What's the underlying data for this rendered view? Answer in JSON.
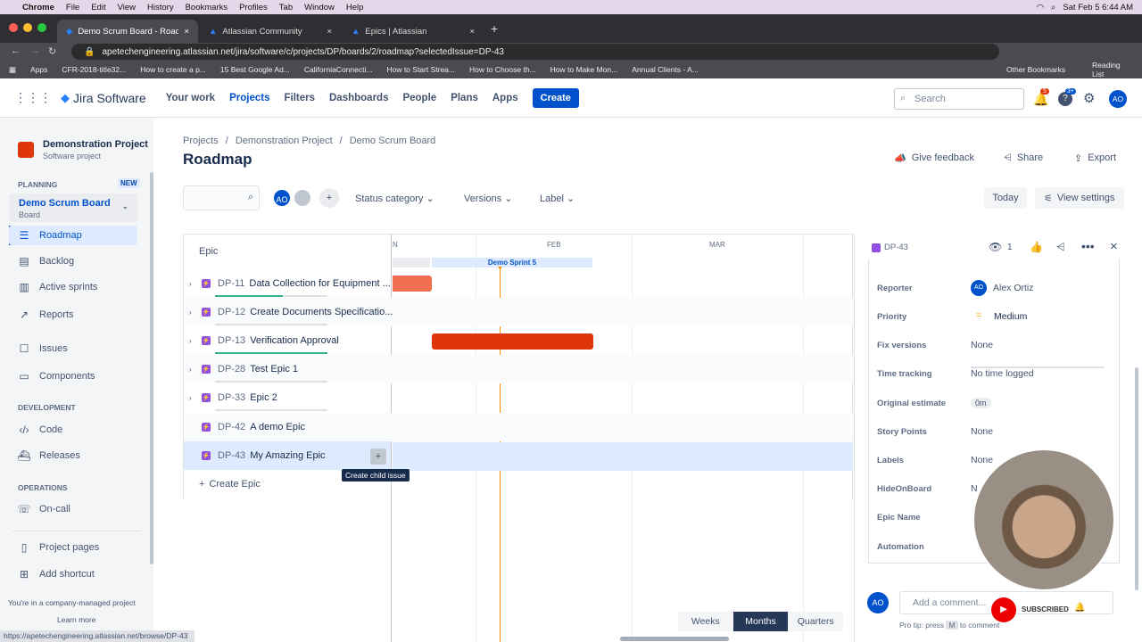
{
  "mac": {
    "apple": "",
    "app": "Chrome",
    "menus": [
      "File",
      "Edit",
      "View",
      "History",
      "Bookmarks",
      "Profiles",
      "Tab",
      "Window",
      "Help"
    ],
    "clock": "Sat Feb 5  6:44 AM"
  },
  "tabs": [
    {
      "label": "Demo Scrum Board - Roadmap"
    },
    {
      "label": "Atlassian Community"
    },
    {
      "label": "Epics | Atlassian"
    }
  ],
  "url": "apetechengineering.atlassian.net/jira/software/c/projects/DP/boards/2/roadmap?selectedIssue=DP-43",
  "bookmarks": [
    "Apps",
    "CFR-2018-title32...",
    "How to create a p...",
    "15 Best Google Ad...",
    "CaliforniaConnecti...",
    "How to Start Strea...",
    "How to Choose th...",
    "How to Make Mon...",
    "Annual Clients - A..."
  ],
  "bookmarks_right": [
    "Other Bookmarks",
    "Reading List"
  ],
  "jira": {
    "logo": "Jira Software",
    "nav": [
      "Your work",
      "Projects",
      "Filters",
      "Dashboards",
      "People",
      "Plans",
      "Apps"
    ],
    "create": "Create",
    "search_placeholder": "Search",
    "notif_count": "5",
    "help_count": "3+",
    "avatar": "AO"
  },
  "sidebar": {
    "project": "Demonstration Project",
    "project_type": "Software project",
    "planning": "PLANNING",
    "new_badge": "NEW",
    "board": "Demo Scrum Board",
    "board_sub": "Board",
    "items": [
      "Roadmap",
      "Backlog",
      "Active sprints",
      "Reports"
    ],
    "items2": [
      "Issues",
      "Components"
    ],
    "development": "DEVELOPMENT",
    "dev_items": [
      "Code",
      "Releases"
    ],
    "operations": "OPERATIONS",
    "ops_items": [
      "On-call"
    ],
    "footer_items": [
      "Project pages",
      "Add shortcut"
    ],
    "managed": "You're in a company-managed project",
    "learn": "Learn more"
  },
  "breadcrumb": [
    "Projects",
    "Demonstration Project",
    "Demo Scrum Board"
  ],
  "page_title": "Roadmap",
  "actions": {
    "feedback": "Give feedback",
    "share": "Share",
    "export": "Export"
  },
  "filters": {
    "status": "Status category",
    "versions": "Versions",
    "label": "Label",
    "today": "Today",
    "view_settings": "View settings",
    "avatar": "AO"
  },
  "roadmap": {
    "epic_col": "Epic",
    "months": [
      "N",
      "FEB",
      "MAR"
    ],
    "sprint": "Demo Sprint 5",
    "rows": [
      {
        "key": "DP-11",
        "summary": "Data Collection for Equipment ...",
        "progress": 0.6,
        "color": "#36b37e"
      },
      {
        "key": "DP-12",
        "summary": "Create Documents Specificatio...",
        "progress": 0,
        "color": "#36b37e"
      },
      {
        "key": "DP-13",
        "summary": "Verification Approval",
        "progress": 1,
        "color": "#36b37e"
      },
      {
        "key": "DP-28",
        "summary": "Test Epic 1",
        "progress": 0,
        "color": "#36b37e"
      },
      {
        "key": "DP-33",
        "summary": "Epic 2",
        "progress": 0,
        "color": "#36b37e"
      },
      {
        "key": "DP-42",
        "summary": "A demo Epic",
        "progress": 0,
        "color": "#36b37e"
      },
      {
        "key": "DP-43",
        "summary": "My Amazing Epic",
        "progress": 0,
        "color": "#36b37e"
      }
    ],
    "tooltip": "Create child issue",
    "create_epic": "Create Epic"
  },
  "detail": {
    "key": "DP-43",
    "watchers": "1",
    "fields": [
      [
        "Reporter",
        "Alex Ortiz"
      ],
      [
        "Priority",
        "Medium"
      ],
      [
        "Fix versions",
        "None"
      ],
      [
        "Time tracking",
        "No time logged"
      ],
      [
        "Original estimate",
        "0m"
      ],
      [
        "Story Points",
        "None"
      ],
      [
        "Labels",
        "None"
      ],
      [
        "HideOnBoard",
        "N"
      ],
      [
        "Epic Name",
        ""
      ],
      [
        "Automation",
        ""
      ]
    ],
    "comment_placeholder": "Add a comment...",
    "protip": "Pro tip: press",
    "protip_key": "M",
    "protip_end": "to comment",
    "subscribed": "SUBSCRIBED"
  },
  "view": {
    "buttons": [
      "Weeks",
      "Months",
      "Quarters"
    ],
    "selected": "Months"
  },
  "status_url": "https://apetechengineering.atlassian.net/browse/DP-43"
}
